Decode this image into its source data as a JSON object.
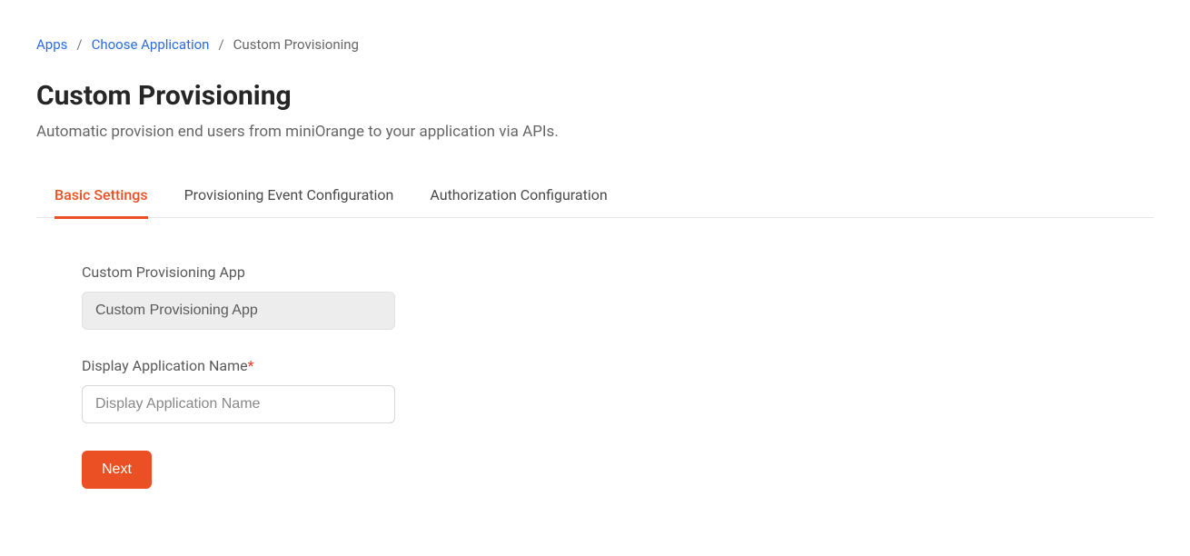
{
  "breadcrumb": {
    "items": [
      {
        "label": "Apps"
      },
      {
        "label": "Choose Application"
      }
    ],
    "current": "Custom Provisioning"
  },
  "header": {
    "title": "Custom Provisioning",
    "subtitle": "Automatic provision end users from miniOrange to your application via APIs."
  },
  "tabs": [
    {
      "label": "Basic Settings",
      "active": true
    },
    {
      "label": "Provisioning Event Configuration",
      "active": false
    },
    {
      "label": "Authorization Configuration",
      "active": false
    }
  ],
  "form": {
    "app_type": {
      "label": "Custom Provisioning App",
      "value": "Custom Provisioning App"
    },
    "display_name": {
      "label": "Display Application Name",
      "placeholder": "Display Application Name",
      "value": "",
      "required": true
    },
    "next_button": "Next"
  }
}
